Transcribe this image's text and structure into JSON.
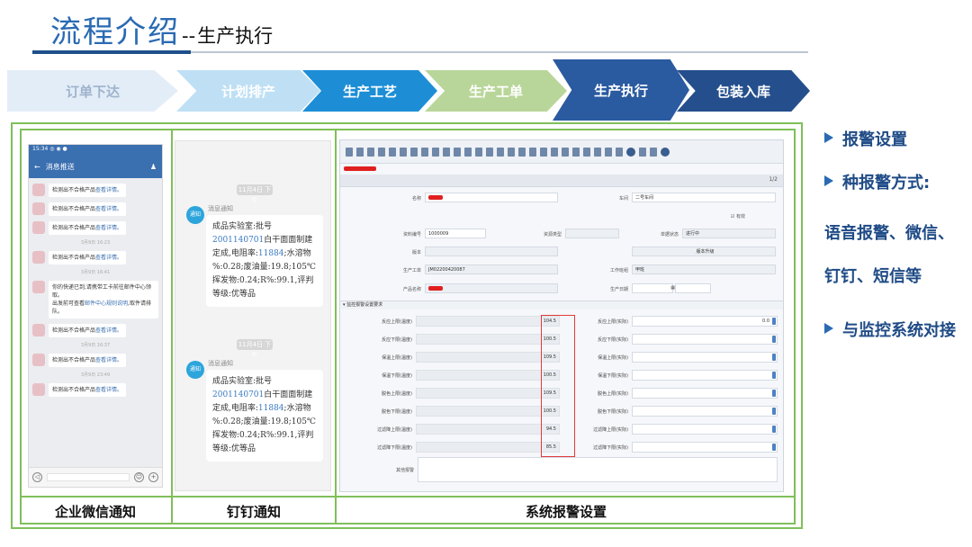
{
  "title": {
    "main": "流程介绍",
    "sep": "--",
    "sub": "生产执行"
  },
  "flow_steps": [
    "订单下达",
    "计划排产",
    "生产工艺",
    "生产工单",
    "生产执行",
    "包装入库"
  ],
  "captions": {
    "wechat": "企业微信通知",
    "ding": "钉钉通知",
    "system": "系统报警设置"
  },
  "wechat": {
    "status": "15:34 ◎ ◉ ●",
    "header_title": "消息推送",
    "back_icon": "back-arrow-icon",
    "person_icon": "person-icon",
    "alert_text": "检测出不合格产品",
    "alert_link": "查看详情。",
    "time1": "3月9日 16:23",
    "time2": "3月9日 16:41",
    "long_msg": "你的快递已到,请携带工卡前往邮件中心领取。",
    "long_msg_2": "出发前可查看",
    "long_msg_link": "邮件中心规则说明",
    "long_msg_3": ",取件请排队。",
    "time3": "3月9日 16:37",
    "time4": "3月9日 23:49"
  },
  "ding": {
    "time1": "11月4日 下午",
    "time2": "11月4日 下午",
    "sender": "消息通知",
    "avatar_text": "通知",
    "msg_prefix": "成品实验室:批号",
    "batch": "2001140701",
    "msg_mid": "白干面面制建定成,电阻率:",
    "resistance": "11884",
    "msg_rest": ";水溶物 %:0.28;废油量:19.8;105℃挥发物:0.24;R%:99.1,评判等级:优等品"
  },
  "system": {
    "page": "1/2",
    "form": {
      "name_label": "名称",
      "workshop_label": "车间",
      "workshop_value": "二号车间",
      "active_label": "有效",
      "prodno_label": "资料编号",
      "prodno_value": "1000009",
      "material_label": "资源类型",
      "status_label": "单据状态",
      "status_value": "进行中",
      "version_label": "版本",
      "upgrade_button": "版本升级",
      "process_label": "生产工单",
      "process_value": "JM02200420087",
      "worker_label": "工作班组",
      "worker_value": "甲班",
      "product_label": "产品名称",
      "date_label": "生产日期"
    },
    "group_label": "▾ 监控报警设置要求",
    "rows_left": [
      {
        "label": "反应上限(温度)",
        "value": "104.5"
      },
      {
        "label": "反应下限(温度)",
        "value": "100.5"
      },
      {
        "label": "保温上限(温度)",
        "value": "109.5"
      },
      {
        "label": "保温下限(温度)",
        "value": "100.5"
      },
      {
        "label": "脱色上限(温度)",
        "value": "109.5"
      },
      {
        "label": "脱色下限(温度)",
        "value": "100.5"
      },
      {
        "label": "过滤降上限(温度)",
        "value": "94.5"
      },
      {
        "label": "过滤降下限(温度)",
        "value": "85.5"
      }
    ],
    "rows_right": [
      {
        "label": "反应上限(实际)",
        "value": "0.0"
      },
      {
        "label": "反应下限(实际)",
        "value": ""
      },
      {
        "label": "保温上限(实际)",
        "value": ""
      },
      {
        "label": "保温下限(实际)",
        "value": ""
      },
      {
        "label": "脱色上限(实际)",
        "value": ""
      },
      {
        "label": "脱色下限(实际)",
        "value": ""
      },
      {
        "label": "过滤降上限(实际)",
        "value": ""
      },
      {
        "label": "过滤降下限(实际)",
        "value": ""
      }
    ],
    "other_label": "其他报警"
  },
  "bullets": [
    "报警设置",
    "种报警方式:",
    "语音报警、微信、钉钉、短信等",
    "与监控系统对接"
  ],
  "colors": {
    "title_blue": "#2a6ab3",
    "active_step": "#2a5aa0",
    "frame_green": "#7fbf5a",
    "alarm_red": "#e43a3a"
  }
}
